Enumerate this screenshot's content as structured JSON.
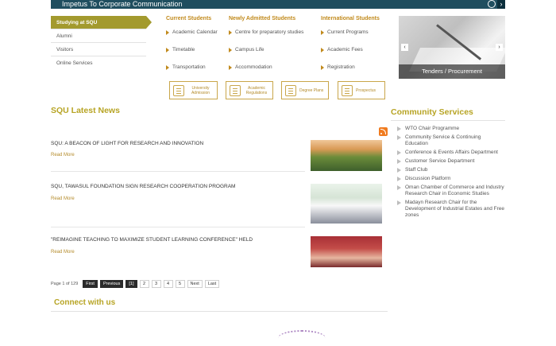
{
  "top_banner": {
    "text": "Impetus To Corporate Communication"
  },
  "left_nav": {
    "items": [
      {
        "label": "Studying at SQU",
        "active": true
      },
      {
        "label": "Alumni"
      },
      {
        "label": "Visitors"
      },
      {
        "label": "Online Services"
      }
    ]
  },
  "menu": {
    "current_students": {
      "title": "Current Students",
      "links": [
        "Academic Calendar",
        "Timetable",
        "Transportation"
      ]
    },
    "newly_admitted": {
      "title": "Newly Admitted Students",
      "links": [
        "Centre for preparatory studies",
        "Campus Life",
        "Accommodation"
      ]
    },
    "international": {
      "title": "International Students",
      "links": [
        "Current Programs",
        "Academic Fees",
        "Registration"
      ]
    }
  },
  "quick_links": [
    {
      "label": "University Admission",
      "icon": "admission-icon"
    },
    {
      "label": "Academic Regulations",
      "icon": "regulations-icon"
    },
    {
      "label": "Degree Plans",
      "icon": "graduation-cap-icon"
    },
    {
      "label": "Prospectus",
      "icon": "book-icon"
    }
  ],
  "tenders": {
    "caption": "Tenders / Procurement"
  },
  "news": {
    "title": "SQU Latest News",
    "items": [
      {
        "headline": "SQU: A BEACON OF LIGHT FOR RESEARCH AND INNOVATION",
        "more": "Read More"
      },
      {
        "headline": "SQU, TAWASUL FOUNDATION SIGN RESEARCH COOPERATION PROGRAM",
        "more": "Read More"
      },
      {
        "headline": "\"REIMAGINE TEACHING TO MAXIMIZE STUDENT LEARNING CONFERENCE\" HELD",
        "more": "Read More"
      }
    ]
  },
  "pager": {
    "info": "Page 1 of 129",
    "first": "First",
    "previous": "Previous",
    "pages": [
      "[1]",
      "2",
      "3",
      "4",
      "5"
    ],
    "next": "Next",
    "last": "Last"
  },
  "connect": {
    "title": "Connect with us"
  },
  "community": {
    "title": "Community Services",
    "items": [
      "WTO Chair Programme",
      "Community Service & Continuing Education",
      "Conference & Events Affairs Department",
      "Customer Service Department",
      "Staff Club",
      "Discussion Platform",
      "Oman Chamber of Commerce and Industry Research Chair in Economic Studies",
      "Madayn Research Chair for the Development of Industrial Estates and Free zones"
    ]
  },
  "colors": {
    "accent": "#b7a424",
    "menu_heading": "#c18a1c",
    "nav_active": "#a39a2e",
    "banner": "#1f4e5f"
  }
}
